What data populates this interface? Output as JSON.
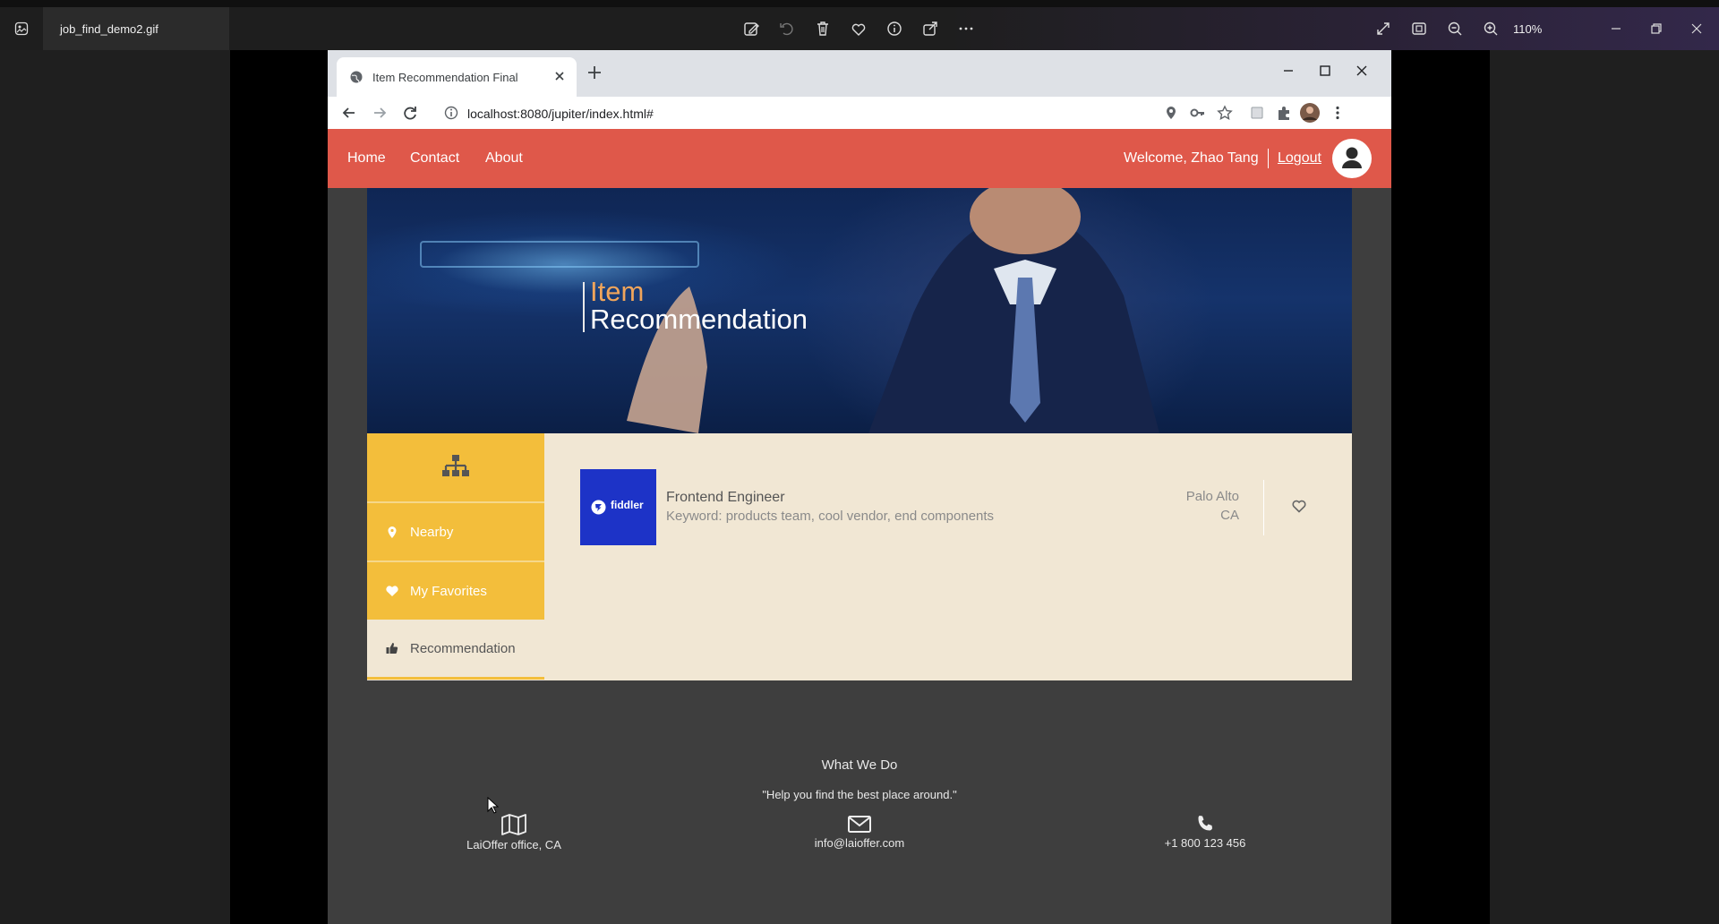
{
  "viewer": {
    "filename": "job_find_demo2.gif",
    "zoom": "110%"
  },
  "browser": {
    "tab_title": "Item Recommendation Final",
    "url": "localhost:8080/jupiter/index.html#"
  },
  "nav": {
    "links": [
      "Home",
      "Contact",
      "About"
    ],
    "welcome": "Welcome, Zhao Tang",
    "logout": "Logout"
  },
  "hero": {
    "title_line1": "Item",
    "title_line2": "Recommendation"
  },
  "sidebar": {
    "items": [
      {
        "label": "Nearby",
        "icon": "map-marker-icon"
      },
      {
        "label": "My Favorites",
        "icon": "heart-icon"
      },
      {
        "label": "Recommendation",
        "icon": "thumbs-up-icon",
        "active": true
      }
    ]
  },
  "job": {
    "logo_text": "fiddler",
    "title": "Frontend Engineer",
    "keywords": "Keyword: products team, cool vendor, end components",
    "city": "Palo Alto",
    "state": "CA",
    "favorite": false
  },
  "footer": {
    "title": "What We Do",
    "quote": "\"Help you find the best place around.\"",
    "address": "LaiOffer office, CA",
    "email": "info@laioffer.com",
    "phone": "+1 800 123 456"
  },
  "colors": {
    "nav_bg": "#df584a",
    "sidebar_accent": "#f3be3b",
    "content_bg": "#f1e7d4",
    "hero_title_accent": "#f0a55b",
    "logo_bg": "#1d33c7"
  }
}
